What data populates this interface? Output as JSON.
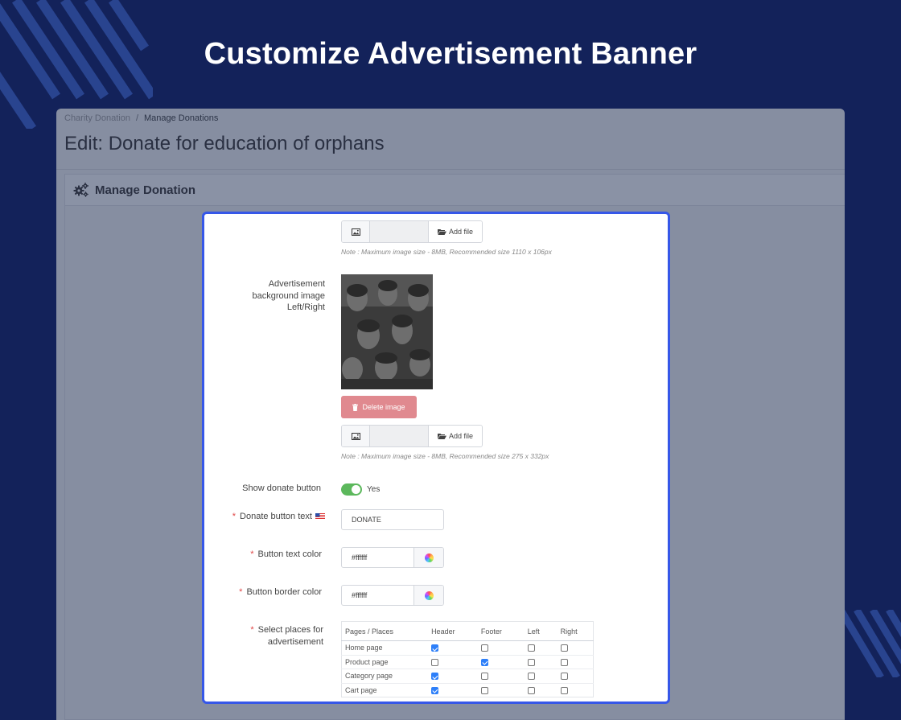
{
  "headline": "Customize Advertisement Banner",
  "colors": {
    "background": "#13225a",
    "accent": "#3657e8",
    "toggle_on": "#5cb85c",
    "delete": "#e0898f",
    "checkbox": "#2d7ff9"
  },
  "admin": {
    "breadcrumb": [
      "Charity Donation",
      "Manage Donations"
    ],
    "breadcrumb_separator": "/",
    "page_title": "Edit: Donate for education of orphans",
    "panel_title": "Manage Donation",
    "panel_icon": "gears-icon"
  },
  "form": {
    "top_file": {
      "button": "Add file",
      "note": "Note : Maximum image size - 8MB, Recommended size 1110 x 106px"
    },
    "background_image": {
      "label_lines": [
        "Advertisement",
        "background image",
        "Left/Right"
      ],
      "delete_button": "Delete image",
      "add_button": "Add file",
      "note": "Note : Maximum image size - 8MB, Recommended size 275 x 332px"
    },
    "show_donate": {
      "label": "Show donate button",
      "value": "Yes",
      "enabled": true
    },
    "donate_text": {
      "required": "*",
      "label": "Donate button text",
      "value": "DONATE",
      "flag_icon": "us-flag-icon"
    },
    "text_color": {
      "required": "*",
      "label": "Button text color",
      "value": "#ffffff"
    },
    "border_color": {
      "required": "*",
      "label": "Button border color",
      "value": "#ffffff"
    },
    "places": {
      "required": "*",
      "label_lines": [
        "Select places for",
        "advertisement"
      ],
      "columns": [
        "Pages / Places",
        "Header",
        "Footer",
        "Left",
        "Right"
      ],
      "rows": [
        {
          "page": "Home page",
          "checks": [
            true,
            false,
            false,
            false
          ]
        },
        {
          "page": "Product page",
          "checks": [
            false,
            true,
            false,
            false
          ]
        },
        {
          "page": "Category page",
          "checks": [
            true,
            false,
            false,
            false
          ]
        },
        {
          "page": "Cart page",
          "checks": [
            true,
            false,
            false,
            false
          ]
        }
      ]
    }
  }
}
